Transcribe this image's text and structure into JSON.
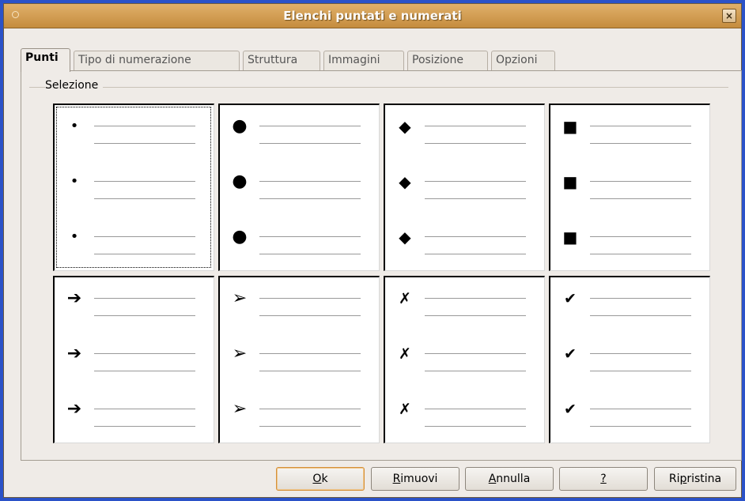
{
  "window": {
    "title": "Elenchi puntati e numerati",
    "close_glyph": "×"
  },
  "tabs": [
    {
      "label": "Punti",
      "active": true
    },
    {
      "label": "Tipo di numerazione",
      "active": false
    },
    {
      "label": "Struttura",
      "active": false
    },
    {
      "label": "Immagini",
      "active": false
    },
    {
      "label": "Posizione",
      "active": false
    },
    {
      "label": "Opzioni",
      "active": false
    }
  ],
  "selection": {
    "label": "Selezione",
    "styles": [
      {
        "name": "small-dot-icon",
        "glyph": "•"
      },
      {
        "name": "large-dot-icon",
        "glyph": "●"
      },
      {
        "name": "diamond-icon",
        "glyph": "◆"
      },
      {
        "name": "square-icon",
        "glyph": "■"
      },
      {
        "name": "arrow-icon",
        "glyph": "➔"
      },
      {
        "name": "arrowhead-icon",
        "glyph": "➢"
      },
      {
        "name": "cross-icon",
        "glyph": "✗"
      },
      {
        "name": "checkmark-icon",
        "glyph": "✔"
      }
    ],
    "selected_index": 0
  },
  "buttons": {
    "ok": {
      "label_mnemonic": "O",
      "label_rest": "k"
    },
    "remove": {
      "label_mnemonic": "R",
      "label_rest": "imuovi"
    },
    "cancel": {
      "label_mnemonic": "A",
      "label_rest": "nnulla"
    },
    "help": {
      "label_mnemonic": "?",
      "label_rest": ""
    },
    "reset": {
      "label_before": "Ri",
      "label_mnemonic": "p",
      "label_rest": "ristina"
    }
  },
  "colors": {
    "titlebar": "#d49a4e",
    "desktop": "#2b52c8",
    "dialog_bg": "#efebe7"
  }
}
